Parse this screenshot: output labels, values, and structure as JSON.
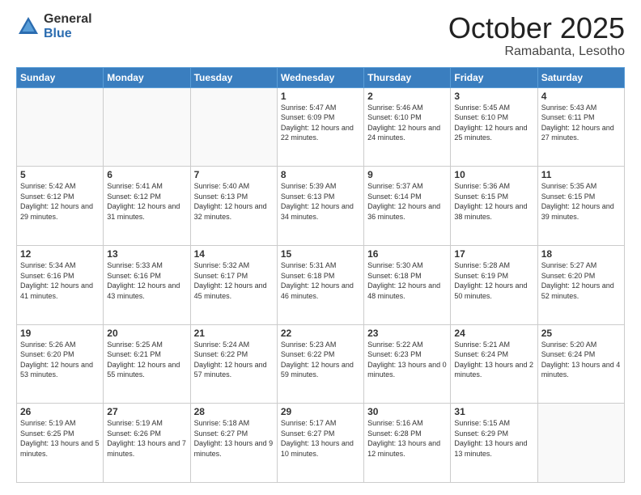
{
  "logo": {
    "general": "General",
    "blue": "Blue"
  },
  "header": {
    "month": "October 2025",
    "location": "Ramabanta, Lesotho"
  },
  "days_of_week": [
    "Sunday",
    "Monday",
    "Tuesday",
    "Wednesday",
    "Thursday",
    "Friday",
    "Saturday"
  ],
  "weeks": [
    [
      {
        "day": "",
        "info": ""
      },
      {
        "day": "",
        "info": ""
      },
      {
        "day": "",
        "info": ""
      },
      {
        "day": "1",
        "info": "Sunrise: 5:47 AM\nSunset: 6:09 PM\nDaylight: 12 hours\nand 22 minutes."
      },
      {
        "day": "2",
        "info": "Sunrise: 5:46 AM\nSunset: 6:10 PM\nDaylight: 12 hours\nand 24 minutes."
      },
      {
        "day": "3",
        "info": "Sunrise: 5:45 AM\nSunset: 6:10 PM\nDaylight: 12 hours\nand 25 minutes."
      },
      {
        "day": "4",
        "info": "Sunrise: 5:43 AM\nSunset: 6:11 PM\nDaylight: 12 hours\nand 27 minutes."
      }
    ],
    [
      {
        "day": "5",
        "info": "Sunrise: 5:42 AM\nSunset: 6:12 PM\nDaylight: 12 hours\nand 29 minutes."
      },
      {
        "day": "6",
        "info": "Sunrise: 5:41 AM\nSunset: 6:12 PM\nDaylight: 12 hours\nand 31 minutes."
      },
      {
        "day": "7",
        "info": "Sunrise: 5:40 AM\nSunset: 6:13 PM\nDaylight: 12 hours\nand 32 minutes."
      },
      {
        "day": "8",
        "info": "Sunrise: 5:39 AM\nSunset: 6:13 PM\nDaylight: 12 hours\nand 34 minutes."
      },
      {
        "day": "9",
        "info": "Sunrise: 5:37 AM\nSunset: 6:14 PM\nDaylight: 12 hours\nand 36 minutes."
      },
      {
        "day": "10",
        "info": "Sunrise: 5:36 AM\nSunset: 6:15 PM\nDaylight: 12 hours\nand 38 minutes."
      },
      {
        "day": "11",
        "info": "Sunrise: 5:35 AM\nSunset: 6:15 PM\nDaylight: 12 hours\nand 39 minutes."
      }
    ],
    [
      {
        "day": "12",
        "info": "Sunrise: 5:34 AM\nSunset: 6:16 PM\nDaylight: 12 hours\nand 41 minutes."
      },
      {
        "day": "13",
        "info": "Sunrise: 5:33 AM\nSunset: 6:16 PM\nDaylight: 12 hours\nand 43 minutes."
      },
      {
        "day": "14",
        "info": "Sunrise: 5:32 AM\nSunset: 6:17 PM\nDaylight: 12 hours\nand 45 minutes."
      },
      {
        "day": "15",
        "info": "Sunrise: 5:31 AM\nSunset: 6:18 PM\nDaylight: 12 hours\nand 46 minutes."
      },
      {
        "day": "16",
        "info": "Sunrise: 5:30 AM\nSunset: 6:18 PM\nDaylight: 12 hours\nand 48 minutes."
      },
      {
        "day": "17",
        "info": "Sunrise: 5:28 AM\nSunset: 6:19 PM\nDaylight: 12 hours\nand 50 minutes."
      },
      {
        "day": "18",
        "info": "Sunrise: 5:27 AM\nSunset: 6:20 PM\nDaylight: 12 hours\nand 52 minutes."
      }
    ],
    [
      {
        "day": "19",
        "info": "Sunrise: 5:26 AM\nSunset: 6:20 PM\nDaylight: 12 hours\nand 53 minutes."
      },
      {
        "day": "20",
        "info": "Sunrise: 5:25 AM\nSunset: 6:21 PM\nDaylight: 12 hours\nand 55 minutes."
      },
      {
        "day": "21",
        "info": "Sunrise: 5:24 AM\nSunset: 6:22 PM\nDaylight: 12 hours\nand 57 minutes."
      },
      {
        "day": "22",
        "info": "Sunrise: 5:23 AM\nSunset: 6:22 PM\nDaylight: 12 hours\nand 59 minutes."
      },
      {
        "day": "23",
        "info": "Sunrise: 5:22 AM\nSunset: 6:23 PM\nDaylight: 13 hours\nand 0 minutes."
      },
      {
        "day": "24",
        "info": "Sunrise: 5:21 AM\nSunset: 6:24 PM\nDaylight: 13 hours\nand 2 minutes."
      },
      {
        "day": "25",
        "info": "Sunrise: 5:20 AM\nSunset: 6:24 PM\nDaylight: 13 hours\nand 4 minutes."
      }
    ],
    [
      {
        "day": "26",
        "info": "Sunrise: 5:19 AM\nSunset: 6:25 PM\nDaylight: 13 hours\nand 5 minutes."
      },
      {
        "day": "27",
        "info": "Sunrise: 5:19 AM\nSunset: 6:26 PM\nDaylight: 13 hours\nand 7 minutes."
      },
      {
        "day": "28",
        "info": "Sunrise: 5:18 AM\nSunset: 6:27 PM\nDaylight: 13 hours\nand 9 minutes."
      },
      {
        "day": "29",
        "info": "Sunrise: 5:17 AM\nSunset: 6:27 PM\nDaylight: 13 hours\nand 10 minutes."
      },
      {
        "day": "30",
        "info": "Sunrise: 5:16 AM\nSunset: 6:28 PM\nDaylight: 13 hours\nand 12 minutes."
      },
      {
        "day": "31",
        "info": "Sunrise: 5:15 AM\nSunset: 6:29 PM\nDaylight: 13 hours\nand 13 minutes."
      },
      {
        "day": "",
        "info": ""
      }
    ]
  ]
}
